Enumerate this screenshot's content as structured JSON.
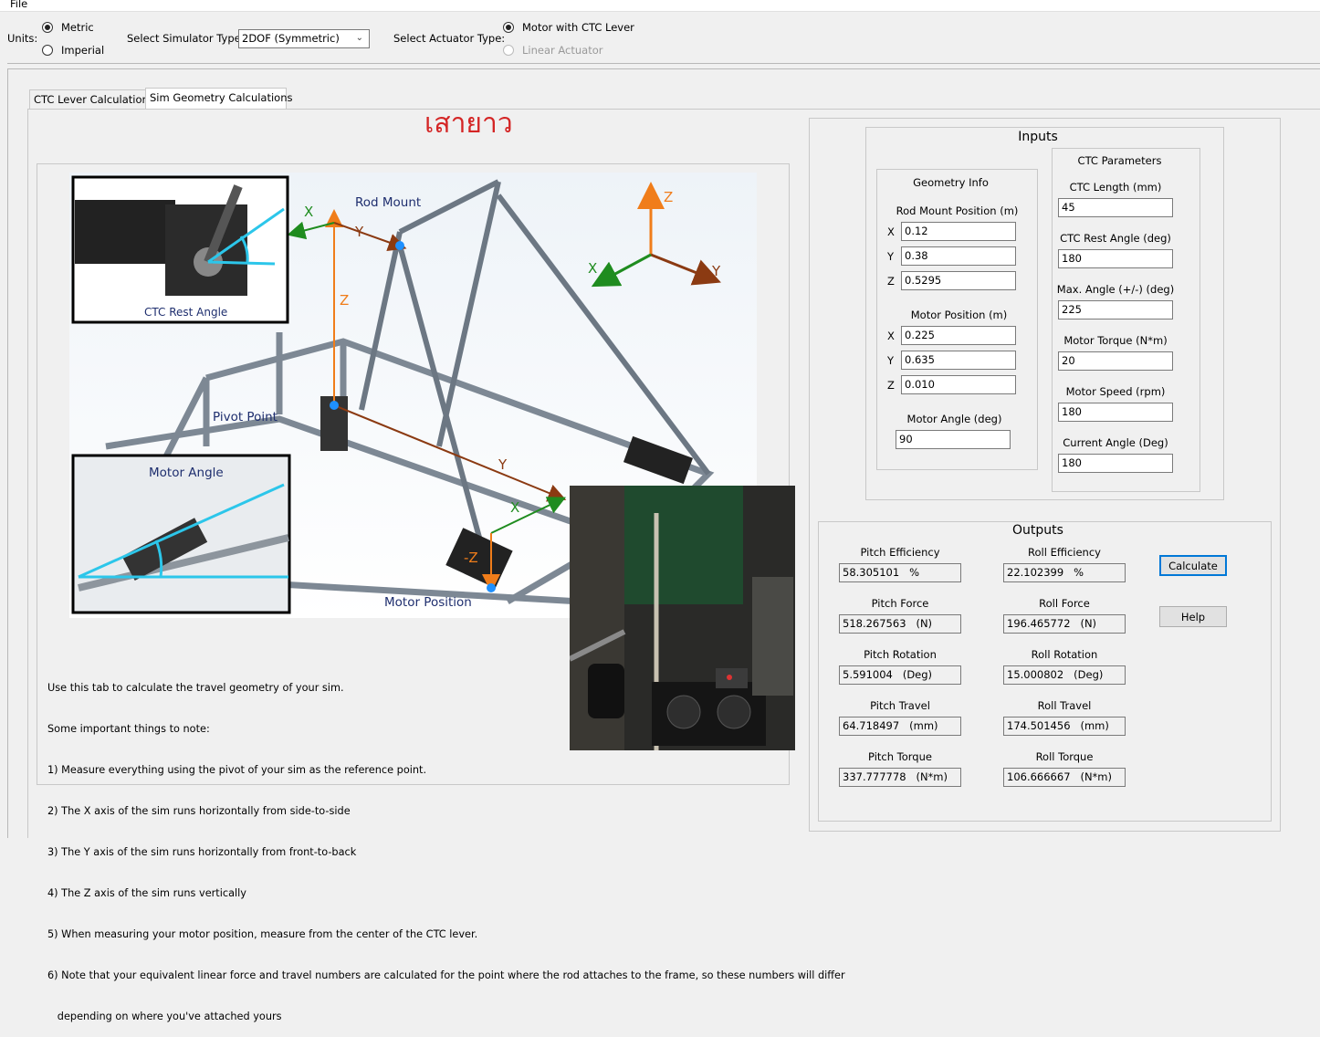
{
  "menu": {
    "file": "File"
  },
  "units": {
    "label": "Units:",
    "options": [
      "Metric",
      "Imperial"
    ],
    "selected": "Metric"
  },
  "simulator": {
    "label": "Select Simulator Type:",
    "value": "2DOF (Symmetric)"
  },
  "actuator": {
    "label": "Select Actuator Type:",
    "options": [
      "Motor with CTC Lever",
      "Linear Actuator"
    ],
    "selected": "Motor with CTC Lever"
  },
  "tabs": [
    {
      "label": "CTC Lever Calculations",
      "active": false
    },
    {
      "label": "Sim Geometry Calculations",
      "active": true
    }
  ],
  "overlay_thai": "เสายาว",
  "diagram": {
    "labels": {
      "rod_mount": "Rod Mount",
      "ctc_rest_angle": "CTC Rest Angle",
      "pivot_point": "Pivot Point",
      "motor_angle": "Motor Angle",
      "motor_position": "Motor Position",
      "x": "X",
      "y": "Y",
      "z": "Z",
      "neg_z": "-Z"
    }
  },
  "notes": [
    "Use this tab to calculate the travel geometry of your sim.",
    "Some important things to note:",
    "1) Measure everything using the pivot of your sim as the reference point.",
    "2) The X axis of the sim runs horizontally from side-to-side",
    "3) The Y axis of the sim runs horizontally from front-to-back",
    "4) The Z axis of the sim runs vertically",
    "5) When measuring your motor position, measure from the center of the CTC lever.",
    "6) Note that your equivalent linear force and travel numbers are calculated for the point where the rod attaches to the frame, so these numbers will differ",
    "   depending on where you've attached yours"
  ],
  "inputs": {
    "title": "Inputs",
    "geometry": {
      "title": "Geometry Info",
      "rod_mount_title": "Rod Mount Position (m)",
      "rod_mount": [
        {
          "axis": "X",
          "value": "0.12"
        },
        {
          "axis": "Y",
          "value": "0.38"
        },
        {
          "axis": "Z",
          "value": "0.5295"
        }
      ],
      "motor_title": "Motor Position (m)",
      "motor": [
        {
          "axis": "X",
          "value": "0.225"
        },
        {
          "axis": "Y",
          "value": "0.635"
        },
        {
          "axis": "Z",
          "value": "0.010"
        }
      ],
      "motor_angle_label": "Motor Angle (deg)",
      "motor_angle": "90"
    },
    "ctc": {
      "title": "CTC Parameters",
      "fields": [
        {
          "label": "CTC Length (mm)",
          "value": "45"
        },
        {
          "label": "CTC Rest Angle (deg)",
          "value": "180"
        },
        {
          "label": "Max. Angle (+/-) (deg)",
          "value": "225"
        },
        {
          "label": "Motor Torque (N*m)",
          "value": "20"
        },
        {
          "label": "Motor Speed (rpm)",
          "value": "180"
        },
        {
          "label": "Current Angle (Deg)",
          "value": "180"
        }
      ]
    }
  },
  "outputs": {
    "title": "Outputs",
    "pitch": [
      {
        "label": "Pitch Efficiency",
        "value": "58.305101   %"
      },
      {
        "label": "Pitch Force",
        "value": "518.267563   (N)"
      },
      {
        "label": "Pitch Rotation",
        "value": "5.591004   (Deg)"
      },
      {
        "label": "Pitch Travel",
        "value": "64.718497   (mm)"
      },
      {
        "label": "Pitch Torque",
        "value": "337.777778   (N*m)"
      }
    ],
    "roll": [
      {
        "label": "Roll Efficiency",
        "value": "22.102399   %"
      },
      {
        "label": "Roll Force",
        "value": "196.465772   (N)"
      },
      {
        "label": "Roll Rotation",
        "value": "15.000802   (Deg)"
      },
      {
        "label": "Roll Travel",
        "value": "174.501456   (mm)"
      },
      {
        "label": "Roll Torque",
        "value": "106.666667   (N*m)"
      }
    ],
    "calculate_button": "Calculate",
    "help_button": "Help"
  }
}
